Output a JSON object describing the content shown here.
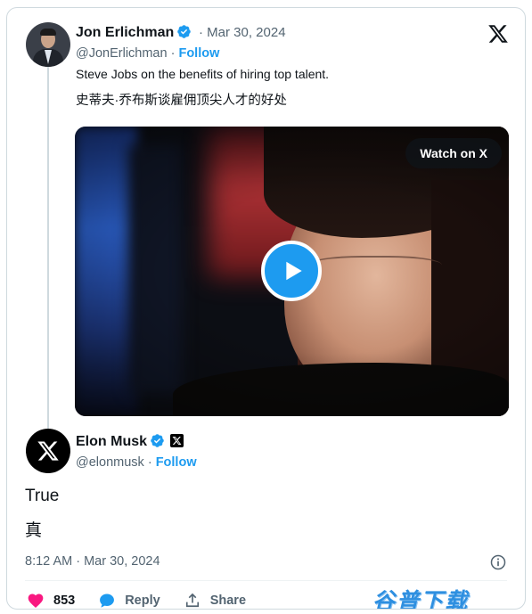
{
  "quoted_tweet": {
    "author_name": "Jon Erlichman",
    "date": "· Mar 30, 2024",
    "handle": "@JonErlichman",
    "follow_label": "Follow",
    "text_en": "Steve Jobs on the benefits of hiring top talent.",
    "text_zh": "史蒂夫·乔布斯谈雇佣顶尖人才的好处",
    "video": {
      "watch_label": "Watch on X"
    }
  },
  "main_tweet": {
    "author_name": "Elon Musk",
    "handle": "@elonmusk",
    "follow_label": "Follow",
    "body_line1": "True",
    "body_line2": "真",
    "timestamp": "8:12 AM · Mar 30, 2024",
    "actions": {
      "like_count": "853",
      "reply_label": "Reply",
      "share_label": "Share"
    }
  },
  "separator": "·",
  "watermark": "谷普下载",
  "colors": {
    "accent": "#1d9bf0",
    "like": "#f91880",
    "muted": "#536471"
  },
  "icons": [
    "verified-badge-icon",
    "x-logo-icon",
    "play-icon",
    "info-icon",
    "heart-icon",
    "reply-icon",
    "share-icon",
    "affiliate-x-icon"
  ]
}
